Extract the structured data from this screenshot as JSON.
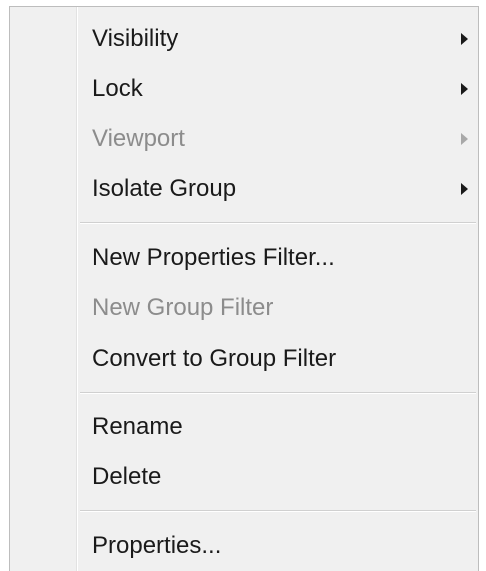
{
  "menu": {
    "items": [
      {
        "label": "Visibility",
        "submenu": true,
        "disabled": false
      },
      {
        "label": "Lock",
        "submenu": true,
        "disabled": false
      },
      {
        "label": "Viewport",
        "submenu": true,
        "disabled": true
      },
      {
        "label": "Isolate Group",
        "submenu": true,
        "disabled": false
      },
      {
        "label": "New Properties Filter...",
        "submenu": false,
        "disabled": false
      },
      {
        "label": "New Group Filter",
        "submenu": false,
        "disabled": true
      },
      {
        "label": "Convert to Group Filter",
        "submenu": false,
        "disabled": false
      },
      {
        "label": "Rename",
        "submenu": false,
        "disabled": false
      },
      {
        "label": "Delete",
        "submenu": false,
        "disabled": false
      },
      {
        "label": "Properties...",
        "submenu": false,
        "disabled": false
      }
    ]
  },
  "colors": {
    "menu_background": "#f0f0f0",
    "text": "#1a1a1a",
    "disabled_text": "#8c8c8c"
  }
}
